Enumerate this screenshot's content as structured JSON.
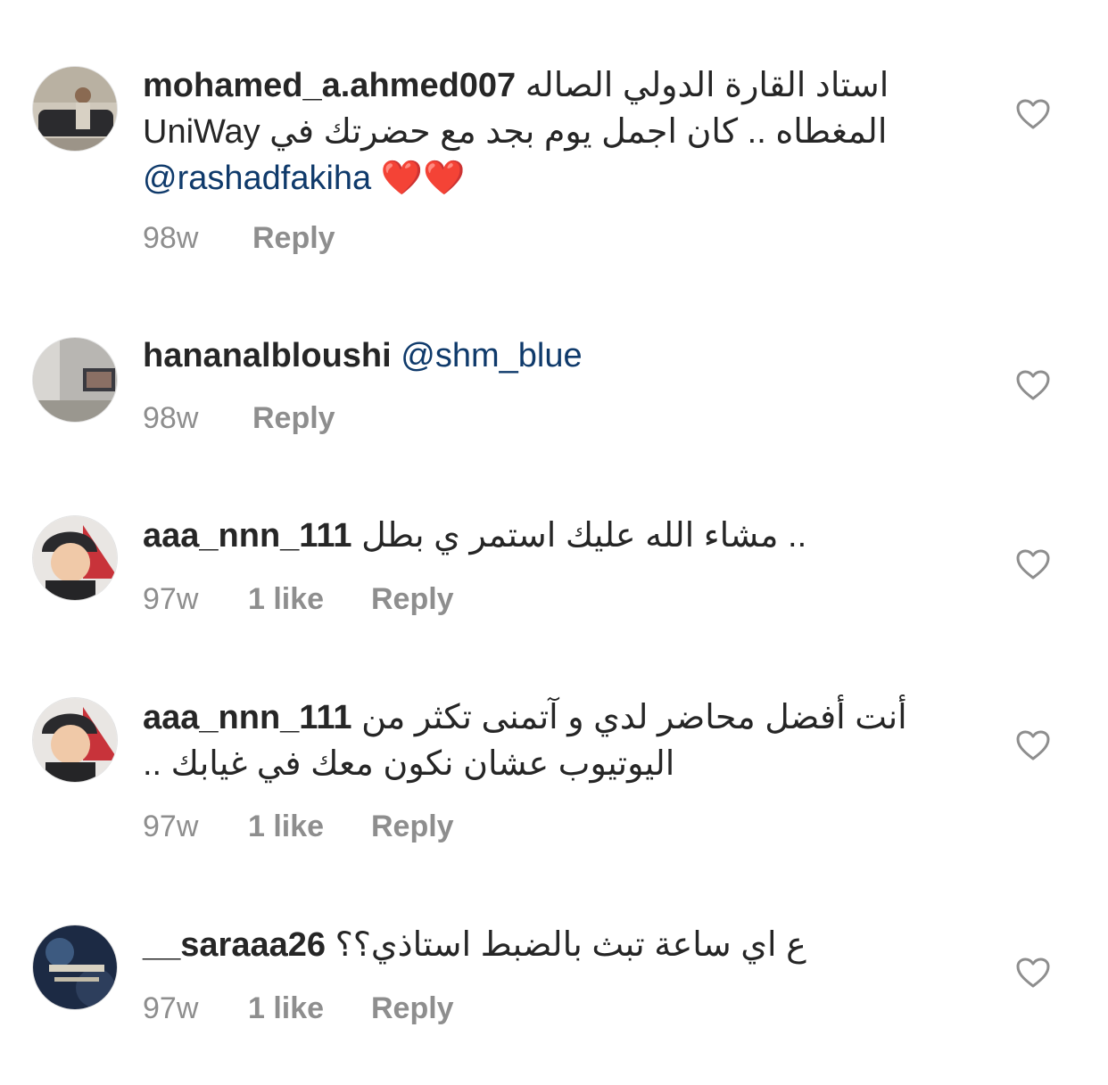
{
  "comments": [
    {
      "username": "mohamed_a.ahmed007",
      "line1": "استاد القارة الدولي الصاله",
      "line2": "المغطاه .. كان اجمل يوم بجد مع حضرتك في UniWay",
      "mention": "@rashadfakiha",
      "emoji": "❤️❤️",
      "time": "98w",
      "likes": "",
      "reply": "Reply"
    },
    {
      "username": "hananalbloushi",
      "mention": "@shm_blue",
      "time": "98w",
      "likes": "",
      "reply": "Reply"
    },
    {
      "username": "aaa_nnn_111",
      "line1": "مشاء الله عليك استمر ي بطل ..",
      "time": "97w",
      "likes": "1 like",
      "reply": "Reply"
    },
    {
      "username": "aaa_nnn_111",
      "line1": "أنت أفضل محاضر لدي و آتمنى تكثر من",
      "line2": "اليوتيوب عشان نكون معك في غيابك ..",
      "time": "97w",
      "likes": "1 like",
      "reply": "Reply"
    },
    {
      "username": "__saraaa26",
      "line1": "ع اي ساعة تبث بالضبط استاذي؟؟",
      "time": "97w",
      "likes": "1 like",
      "reply": "Reply"
    }
  ],
  "icons": {
    "like": "heart-outline-icon"
  },
  "colors": {
    "text": "#262626",
    "meta": "#8e8e8e",
    "mention": "#0f3a6b",
    "heart": "#8e8e8e"
  }
}
